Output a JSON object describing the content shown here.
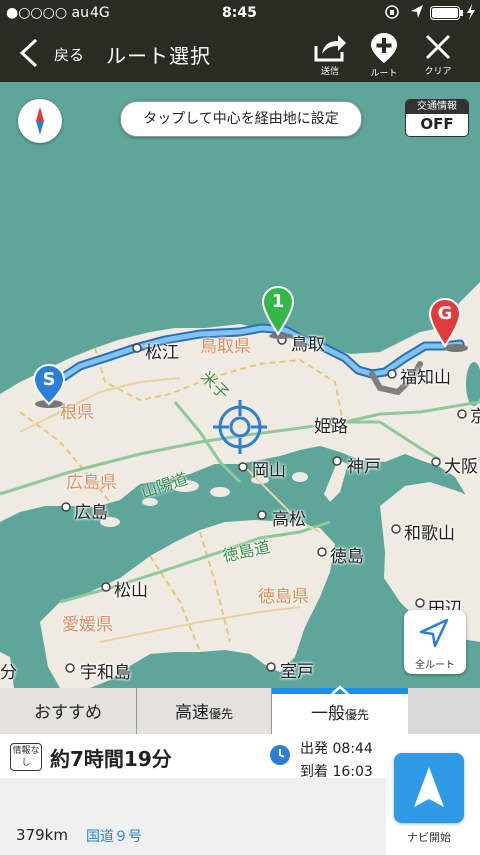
{
  "status_bar": {
    "carrier": "●○○○○ au",
    "network": "4G",
    "time": "8:45"
  },
  "nav": {
    "back_label": "戻る",
    "title": "ルート選択",
    "actions": [
      {
        "label": "送信",
        "icon": "share-icon"
      },
      {
        "label": "ルート",
        "icon": "add-waypoint-icon"
      },
      {
        "label": "クリア",
        "icon": "close-icon"
      }
    ]
  },
  "map": {
    "tap_hint": "タップして中心を経由地に設定",
    "traffic": {
      "title": "交通情報",
      "value": "OFF"
    },
    "all_route_label": "全ルート",
    "markers": {
      "start": "S",
      "waypoint": "1",
      "goal": "G"
    },
    "cities": [
      "松江",
      "鳥取",
      "福知山",
      "姫路",
      "岡山",
      "神戸",
      "大阪",
      "広島",
      "高松",
      "和歌山",
      "徳島",
      "松山",
      "宇和島",
      "室戸",
      "田辺"
    ],
    "prefectures": [
      "鳥取県",
      "根県",
      "広島県",
      "徳島県",
      "愛媛県",
      "米子"
    ],
    "roads": [
      "山陽道",
      "徳島道"
    ],
    "edge_labels": [
      "分",
      "京"
    ],
    "colors": {
      "sea": "#5ea69a",
      "land": "#efeae2",
      "route": "#5aa8e8",
      "accent": "#1e8fe0"
    }
  },
  "tabs": [
    {
      "label": "おすすめ",
      "suffix": ""
    },
    {
      "label": "高速",
      "suffix": "優先"
    },
    {
      "label": "一般",
      "suffix": "優先",
      "active": true
    }
  ],
  "route_info": {
    "badge": "情報なし",
    "duration": "約7時間19分",
    "departure": "出発 08:44",
    "arrival": "到着 16:03",
    "distance": "379km",
    "road": "国道９号",
    "navi_start_label": "ナビ開始"
  }
}
